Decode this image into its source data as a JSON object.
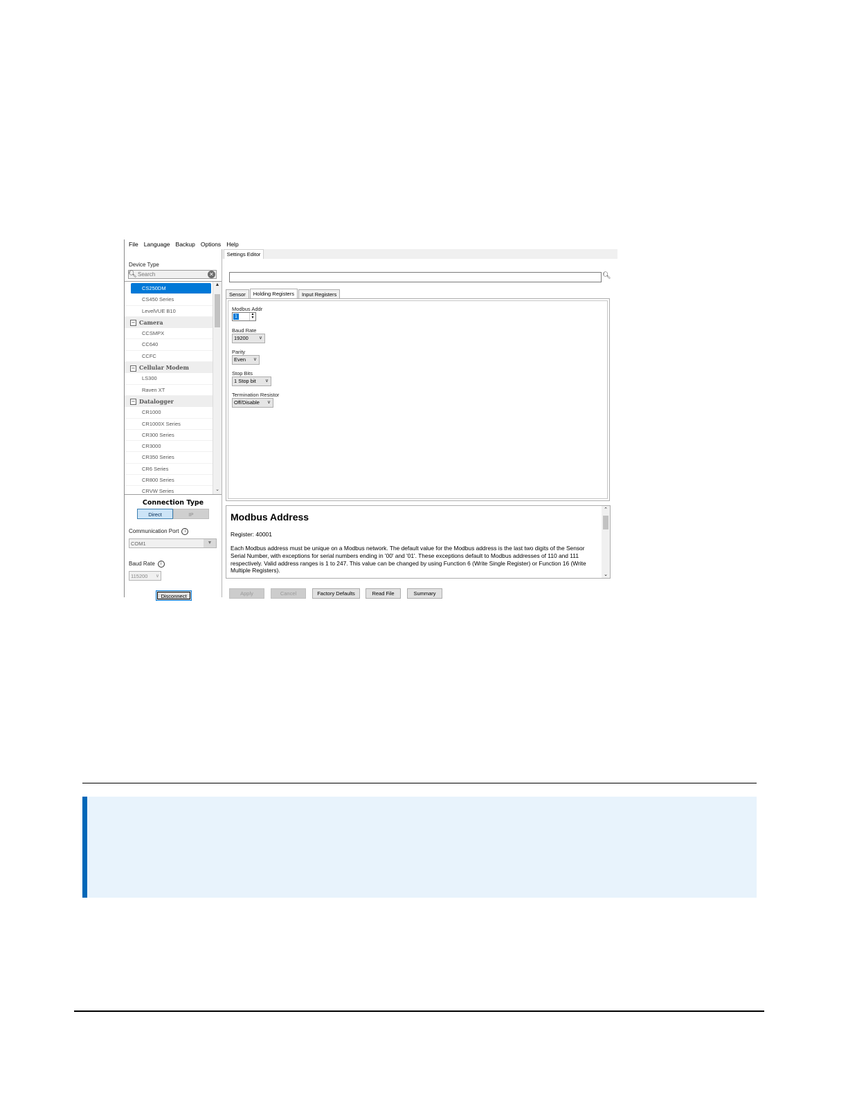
{
  "menu": [
    "File",
    "Language",
    "Backup",
    "Options",
    "Help"
  ],
  "left_panel": {
    "device_type_label": "Device Type",
    "search_placeholder": "Search",
    "devices": [
      {
        "kind": "item",
        "label": "CS250DM",
        "selected": true
      },
      {
        "kind": "item",
        "label": "CS450 Series"
      },
      {
        "kind": "item",
        "label": "LevelVUE B10"
      },
      {
        "kind": "category",
        "label": "Camera"
      },
      {
        "kind": "item",
        "label": "CCSMPX"
      },
      {
        "kind": "item",
        "label": "CC640"
      },
      {
        "kind": "item",
        "label": "CCFC"
      },
      {
        "kind": "category",
        "label": "Cellular Modem"
      },
      {
        "kind": "item",
        "label": "LS300"
      },
      {
        "kind": "item",
        "label": "Raven XT"
      },
      {
        "kind": "category",
        "label": "Datalogger"
      },
      {
        "kind": "item",
        "label": "CR1000"
      },
      {
        "kind": "item",
        "label": "CR1000X Series"
      },
      {
        "kind": "item",
        "label": "CR300 Series"
      },
      {
        "kind": "item",
        "label": "CR3000"
      },
      {
        "kind": "item",
        "label": "CR350 Series"
      },
      {
        "kind": "item",
        "label": "CR6 Series"
      },
      {
        "kind": "item",
        "label": "CR800 Series"
      },
      {
        "kind": "item",
        "label": "CRVW Series"
      }
    ],
    "connection_type_title": "Connection Type",
    "direct_label": "Direct",
    "ip_label": "IP",
    "comm_port_label": "Communication Port",
    "comm_port_value": "COM1",
    "baud_rate_label": "Baud Rate",
    "baud_rate_value": "115200",
    "disconnect_label": "Disconnect"
  },
  "right_panel": {
    "settings_tab": "Settings Editor",
    "filter_value": "",
    "subtabs": [
      "Sensor",
      "Holding Registers",
      "Input Registers"
    ],
    "active_subtab": "Holding Registers",
    "fields": {
      "modbus_addr_label": "Modbus Addr",
      "modbus_addr_value": "1",
      "baud_label": "Baud Rate",
      "baud_value": "19200",
      "parity_label": "Parity",
      "parity_value": "Even",
      "stop_bits_label": "Stop Bits",
      "stop_bits_value": "1 Stop bit",
      "termination_label": "Termination Resistor",
      "termination_value": "Off/Disable"
    },
    "help": {
      "title": "Modbus Address",
      "register": "Register: 40001",
      "body": "Each Modbus address must be unique on a Modbus network. The default value for the Modbus address is the last two digits of the Sensor Serial Number, with exceptions for serial numbers ending in '00' and '01'. These exceptions default to Modbus addresses of 110 and 111 respectively. Valid address ranges is 1 to 247. This value can be changed by using Function 6 (Write Single Register) or Function 16 (Write Multiple Registers)."
    },
    "buttons": {
      "apply": "Apply",
      "cancel": "Cancel",
      "factory_defaults": "Factory Defaults",
      "read_file": "Read File",
      "summary": "Summary"
    }
  },
  "colors": {
    "selection": "#0078d7",
    "note_background": "#e8f3fc",
    "note_accent": "#0067b8"
  }
}
